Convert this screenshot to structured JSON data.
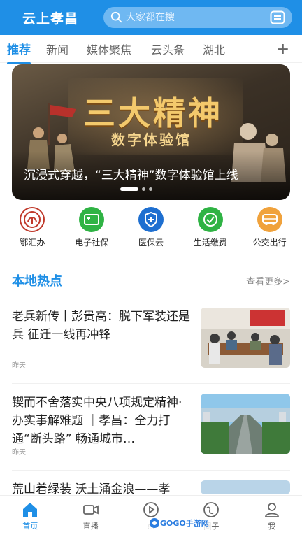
{
  "header": {
    "title": "云上孝昌",
    "search_placeholder": "大家都在搜",
    "search_icon": "search-icon",
    "scan_icon": "scan-icon"
  },
  "tabs": [
    {
      "label": "推荐",
      "active": true
    },
    {
      "label": "新闻"
    },
    {
      "label": "媒体聚焦"
    },
    {
      "label": "云头条"
    },
    {
      "label": "湖北"
    }
  ],
  "tab_add": "+",
  "banner": {
    "title": "三大精神",
    "subtitle": "数字体验馆",
    "caption": "沉浸式穿越，“三大精神”数字体验馆上线"
  },
  "services": [
    {
      "label": "鄂汇办",
      "icon": "ehuiban-icon",
      "color": "#c0392b"
    },
    {
      "label": "电子社保",
      "icon": "social-security-card-icon",
      "color": "#2fb344"
    },
    {
      "label": "医保云",
      "icon": "medical-insurance-shield-icon",
      "color": "#1e6fd0"
    },
    {
      "label": "生活缴费",
      "icon": "checkmark-icon",
      "color": "#2fb344"
    },
    {
      "label": "公交出行",
      "icon": "bus-icon",
      "color": "#f0a23c"
    }
  ],
  "section": {
    "title": "本地热点",
    "more": "查看更多>"
  },
  "news": [
    {
      "title": "老兵新传丨彭贵高：脱下军装还是兵 征迁一线再冲锋",
      "time": "昨天"
    },
    {
      "title": "锲而不舍落实中央八项规定精神·办实事解难题 ｜孝昌：全力打通“断头路” 畅通城市…",
      "time": "昨天"
    },
    {
      "title": "荒山着绿装 沃土涌金浪——孝",
      "time": ""
    }
  ],
  "bottom_nav": [
    {
      "label": "首页",
      "icon": "home-icon",
      "active": true
    },
    {
      "label": "直播",
      "icon": "video-camera-icon"
    },
    {
      "label": "点",
      "icon": "play-circle-icon"
    },
    {
      "label": "圈子",
      "icon": "globe-icon"
    },
    {
      "label": "我",
      "icon": "user-icon"
    }
  ],
  "watermark": "GOGO手游网",
  "colors": {
    "brand": "#1f8fe6"
  }
}
